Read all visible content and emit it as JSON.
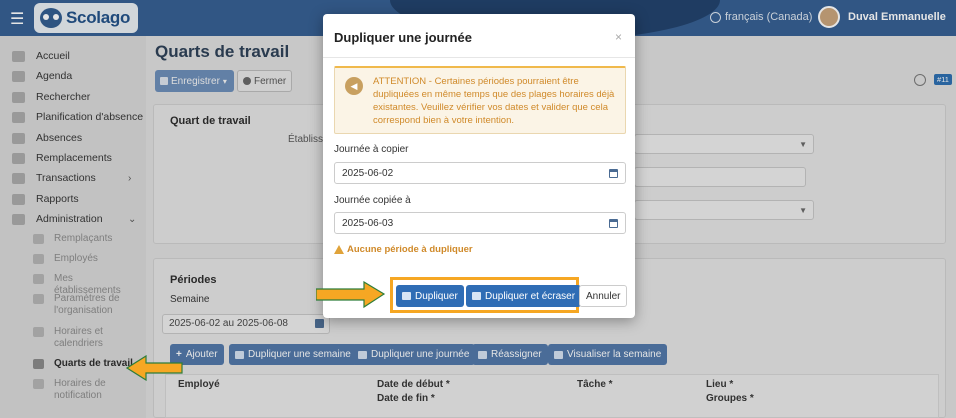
{
  "header": {
    "app_name": "Scolago",
    "language": "français (Canada)",
    "user_name": "Duval Emmanuelle"
  },
  "sidebar": {
    "items": [
      {
        "label": "Accueil",
        "icon": "home-icon"
      },
      {
        "label": "Agenda",
        "icon": "calendar-icon"
      },
      {
        "label": "Rechercher",
        "icon": "search-icon"
      },
      {
        "label": "Planification d'absence",
        "icon": "calendar-icon"
      },
      {
        "label": "Absences",
        "icon": "user-minus-icon"
      },
      {
        "label": "Remplacements",
        "icon": "swap-icon"
      },
      {
        "label": "Transactions",
        "icon": "list-icon",
        "chevron": "›"
      },
      {
        "label": "Rapports",
        "icon": "report-icon"
      },
      {
        "label": "Administration",
        "icon": "gear-icon",
        "chevron": "⌄"
      }
    ],
    "sub_items": [
      {
        "label": "Remplaçants",
        "icon": "user-icon"
      },
      {
        "label": "Employés",
        "icon": "users-icon"
      },
      {
        "label": "Mes établissements",
        "icon": "building-icon"
      },
      {
        "label": "Paramètres de l'organisation",
        "icon": "settings-icon"
      },
      {
        "label": "Horaires et calendriers",
        "icon": "calendar-icon"
      },
      {
        "label": "Quarts de travail",
        "icon": "edit-calendar-icon",
        "active": true
      },
      {
        "label": "Horaires de notification",
        "icon": "bell-icon"
      }
    ]
  },
  "main": {
    "title": "Quarts de travail",
    "save_label": "Enregistrer",
    "close_label": "Fermer",
    "badge": "#11",
    "section1_title": "Quart de travail",
    "establishment_label": "Établisse",
    "section2_title": "Périodes",
    "week_label": "Semaine",
    "week_value": "2025-06-02 au 2025-06-08",
    "actions": [
      "Ajouter",
      "Dupliquer une semaine",
      "Dupliquer une journée",
      "Réassigner",
      "Visualiser la semaine"
    ],
    "table_headers": {
      "employee": "Employé",
      "start_date": "Date de début *",
      "end_date": "Date de fin *",
      "task": "Tâche *",
      "place": "Lieu *",
      "groups": "Groupes *"
    }
  },
  "modal": {
    "title": "Dupliquer une journée",
    "close_symbol": "×",
    "alert_text": "ATTENTION - Certaines périodes pourraient être dupliquées en même temps que des plages horaires déjà existantes. Veuillez vérifier vos dates et valider que cela correspond bien à votre intention.",
    "copy_label": "Journée à copier",
    "copy_value": "2025-06-02",
    "target_label": "Journée copiée à",
    "target_value": "2025-06-03",
    "warning_text": "Aucune période à dupliquer",
    "btn_duplicate": "Dupliquer",
    "btn_duplicate_overwrite": "Dupliquer et écraser",
    "btn_cancel": "Annuler"
  },
  "colors": {
    "header": "#335d91",
    "primary": "#2f6db5",
    "highlight": "#f6a723",
    "warning": "#d08a2a"
  }
}
